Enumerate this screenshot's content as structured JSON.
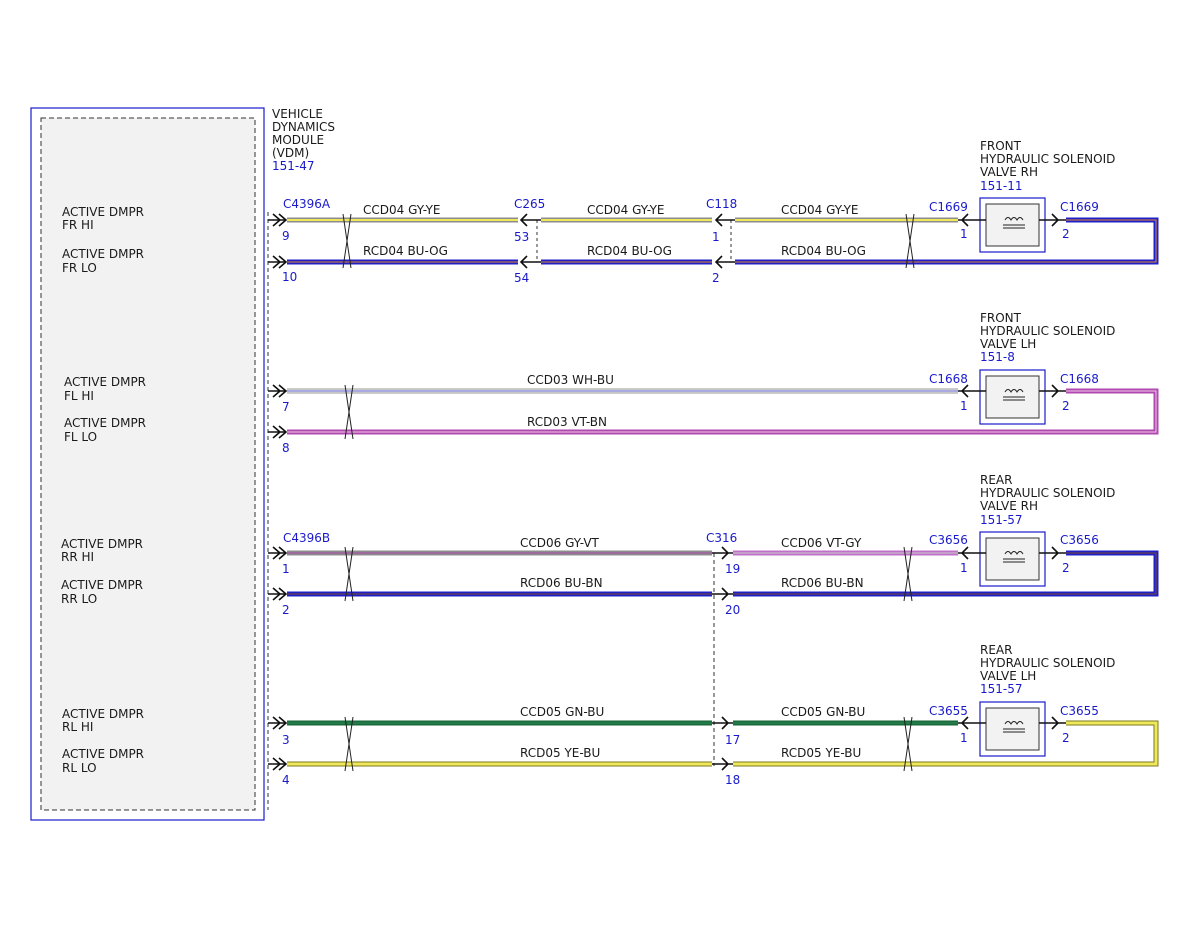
{
  "module": {
    "title_lines": [
      "VEHICLE",
      "DYNAMICS",
      "MODULE",
      "(VDM)"
    ],
    "ref": "151-47"
  },
  "colors": {
    "module_border": "#1a1acc",
    "text_blue": "#1a1acc",
    "GY": "#8c8c8c",
    "YE": "#f0e85a",
    "BU": "#2020c8",
    "OG": "#e08a2a",
    "WH": "#f4f4f4",
    "VT": "#b04ab0",
    "BN": "#7a4a2a",
    "GN": "#1a6a3a"
  },
  "circuits": [
    {
      "id": "fr",
      "pin_labels": [
        [
          "ACTIVE DMPR",
          "FR HI"
        ],
        [
          "ACTIVE DMPR",
          "FR LO"
        ]
      ],
      "vdm_connector": "C4396A",
      "vdm_pins": [
        "9",
        "10"
      ],
      "segments": [
        {
          "hi_label": "CCD04  GY-YE",
          "lo_label": "RCD04  BU-OG"
        },
        {
          "hi_label": "CCD04  GY-YE",
          "lo_label": "RCD04  BU-OG"
        },
        {
          "hi_label": "CCD04  GY-YE",
          "lo_label": "RCD04  BU-OG"
        }
      ],
      "inline": [
        {
          "name": "C265",
          "pins": [
            "53",
            "54"
          ]
        },
        {
          "name": "C118",
          "pins": [
            "1",
            "2"
          ]
        }
      ],
      "solenoid": {
        "name_lines": [
          "FRONT",
          "HYDRAULIC SOLENOID",
          "VALVE RH"
        ],
        "ref": "151-11",
        "connector": "C1669",
        "pin_in": "1",
        "pin_out": "2"
      }
    },
    {
      "id": "fl",
      "pin_labels": [
        [
          "ACTIVE DMPR",
          "FL HI"
        ],
        [
          "ACTIVE DMPR",
          "FL LO"
        ]
      ],
      "vdm_connector": "",
      "vdm_pins": [
        "7",
        "8"
      ],
      "segments": [
        {
          "hi_label": "CCD03  WH-BU",
          "lo_label": "RCD03  VT-BN"
        }
      ],
      "inline": [],
      "solenoid": {
        "name_lines": [
          "FRONT",
          "HYDRAULIC SOLENOID",
          "VALVE LH"
        ],
        "ref": "151-8",
        "connector": "C1668",
        "pin_in": "1",
        "pin_out": "2"
      }
    },
    {
      "id": "rr",
      "pin_labels": [
        [
          "ACTIVE DMPR",
          "RR HI"
        ],
        [
          "ACTIVE DMPR",
          "RR LO"
        ]
      ],
      "vdm_connector": "C4396B",
      "vdm_pins": [
        "1",
        "2"
      ],
      "segments": [
        {
          "hi_label": "CCD06  GY-VT",
          "lo_label": "RCD06  BU-BN"
        },
        {
          "hi_label": "CCD06  VT-GY",
          "lo_label": "RCD06  BU-BN"
        }
      ],
      "inline": [
        {
          "name": "C316",
          "pins": [
            "19",
            "20"
          ]
        }
      ],
      "solenoid": {
        "name_lines": [
          "REAR",
          "HYDRAULIC SOLENOID",
          "VALVE RH"
        ],
        "ref": "151-57",
        "connector": "C3656",
        "pin_in": "1",
        "pin_out": "2"
      }
    },
    {
      "id": "rl",
      "pin_labels": [
        [
          "ACTIVE DMPR",
          "RL HI"
        ],
        [
          "ACTIVE DMPR",
          "RL LO"
        ]
      ],
      "vdm_connector": "",
      "vdm_pins": [
        "3",
        "4"
      ],
      "segments": [
        {
          "hi_label": "CCD05  GN-BU",
          "lo_label": "RCD05  YE-BU"
        },
        {
          "hi_label": "CCD05  GN-BU",
          "lo_label": "RCD05  YE-BU"
        }
      ],
      "inline": [
        {
          "name": "",
          "pins": [
            "17",
            "18"
          ]
        }
      ],
      "solenoid": {
        "name_lines": [
          "REAR",
          "HYDRAULIC SOLENOID",
          "VALVE LH"
        ],
        "ref": "151-57",
        "connector": "C3655",
        "pin_in": "1",
        "pin_out": "2"
      }
    }
  ]
}
